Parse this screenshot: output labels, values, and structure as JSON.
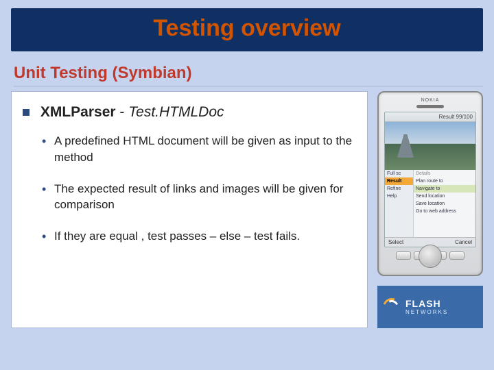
{
  "title": "Testing overview",
  "subtitle": "Unit Testing (Symbian)",
  "section": {
    "name": "XMLParser",
    "separator": " - ",
    "testcase": "Test.HTMLDoc"
  },
  "bullets": [
    "A predefined HTML document will be given as input to the method",
    "The expected result of links and images will be given for comparison",
    "If they are equal , test passes – else – test fails."
  ],
  "phone": {
    "brand": "NOKIA",
    "status": "Result 99/100",
    "leftTabs": [
      "Full sc",
      "Result",
      "Refine",
      "Help"
    ],
    "rightHint": "Details",
    "rightItems": [
      "Plan route to",
      "Navigate to",
      "Send location",
      "Save location",
      "Go to web address"
    ],
    "softLeft": "Select",
    "softRight": "Cancel"
  },
  "logo": {
    "line1": "FLASH",
    "line2": "NETWORKS"
  }
}
